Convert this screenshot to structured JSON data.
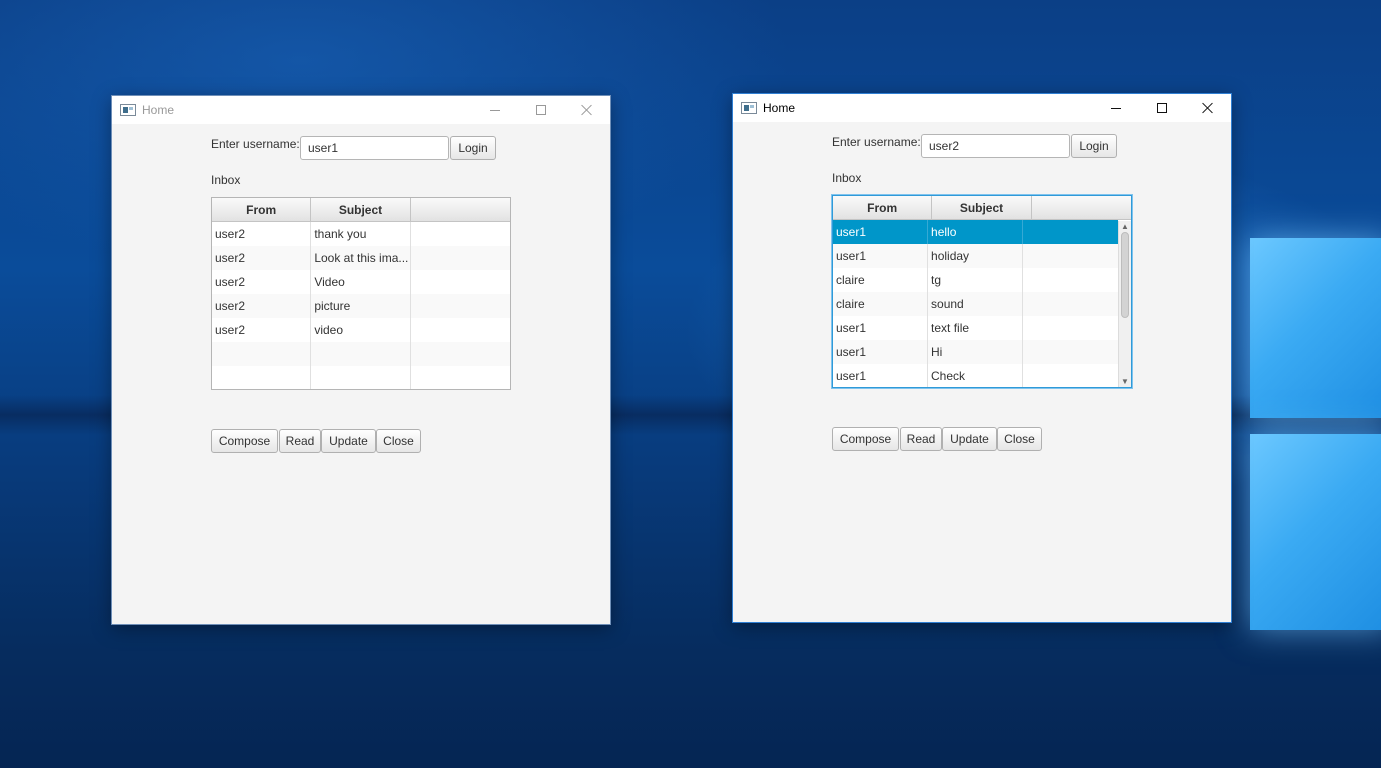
{
  "windows": [
    {
      "title": "Home",
      "state": "inactive",
      "username_label": "Enter username:",
      "username_value": "user1",
      "login_label": "Login",
      "inbox_label": "Inbox",
      "columns": [
        "From",
        "Subject",
        ""
      ],
      "rows": [
        {
          "from": "user2",
          "subject": "thank you"
        },
        {
          "from": "user2",
          "subject": "Look at this ima..."
        },
        {
          "from": "user2",
          "subject": "Video"
        },
        {
          "from": "user2",
          "subject": "picture"
        },
        {
          "from": "user2",
          "subject": "video"
        },
        {
          "from": "",
          "subject": ""
        },
        {
          "from": "",
          "subject": ""
        }
      ],
      "selected_row": null,
      "buttons": [
        "Compose",
        "Read",
        "Update",
        "Close"
      ]
    },
    {
      "title": "Home",
      "state": "active",
      "username_label": "Enter username:",
      "username_value": "user2",
      "login_label": "Login",
      "inbox_label": "Inbox",
      "columns": [
        "From",
        "Subject",
        ""
      ],
      "rows": [
        {
          "from": "user1",
          "subject": "hello"
        },
        {
          "from": "user1",
          "subject": "holiday"
        },
        {
          "from": "claire",
          "subject": "tg"
        },
        {
          "from": "claire",
          "subject": "sound"
        },
        {
          "from": "user1",
          "subject": "text file"
        },
        {
          "from": "user1",
          "subject": "Hi"
        },
        {
          "from": "user1",
          "subject": "Check"
        }
      ],
      "selected_row": 0,
      "buttons": [
        "Compose",
        "Read",
        "Update",
        "Close"
      ]
    }
  ],
  "icons": {
    "scroll_up": "▲",
    "scroll_down": "▼"
  },
  "colors": {
    "selection": "#0096c9",
    "focus_border": "#2f9ad8"
  }
}
